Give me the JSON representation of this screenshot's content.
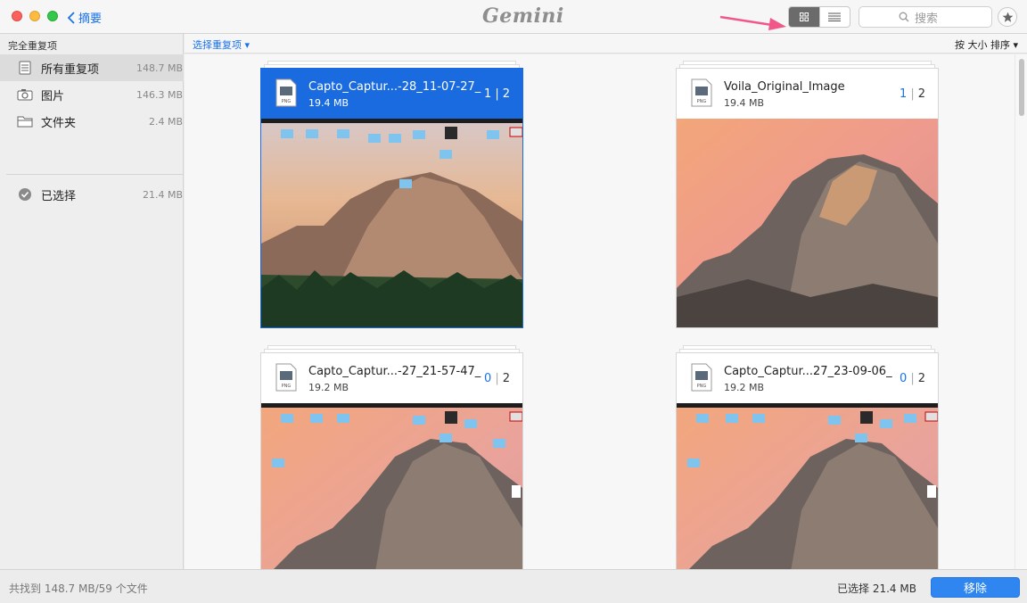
{
  "titlebar": {
    "back_label": "摘要",
    "logo": "Gemini",
    "search_placeholder": "搜索"
  },
  "sidebar": {
    "heading": "完全重复项",
    "items": [
      {
        "label": "所有重复项",
        "size": "148.7 MB",
        "icon": "stack-icon",
        "active": true
      },
      {
        "label": "图片",
        "size": "146.3 MB",
        "icon": "camera-icon",
        "active": false
      },
      {
        "label": "文件夹",
        "size": "2.4 MB",
        "icon": "folder-icon",
        "active": false
      }
    ],
    "selected": {
      "label": "已选择",
      "size": "21.4 MB",
      "icon": "check-circle-icon"
    }
  },
  "toolbar": {
    "select_duplicates": "选择重复项 ▾",
    "sort": "按 大小 排序 ▾"
  },
  "cards": [
    {
      "name": "Capto_Captur...-28_11-07-27_",
      "size": "19.4 MB",
      "selected_count": "1",
      "total": "2",
      "selected": true,
      "thumb": "screenshot"
    },
    {
      "name": "Voila_Original_Image",
      "size": "19.4 MB",
      "selected_count": "1",
      "total": "2",
      "selected": false,
      "thumb": "photo"
    },
    {
      "name": "Capto_Captur...-27_21-57-47_",
      "size": "19.2 MB",
      "selected_count": "0",
      "total": "2",
      "selected": false,
      "thumb": "screenshot"
    },
    {
      "name": "Capto_Captur...27_23-09-06_",
      "size": "19.2 MB",
      "selected_count": "0",
      "total": "2",
      "selected": false,
      "thumb": "screenshot"
    }
  ],
  "bottom": {
    "found": "共找到 148.7 MB/59 个文件",
    "selected_total": "已选择 21.4 MB",
    "remove_label": "移除"
  },
  "colors": {
    "accent": "#1a6be0",
    "annotation_arrow": "#f0588a"
  }
}
